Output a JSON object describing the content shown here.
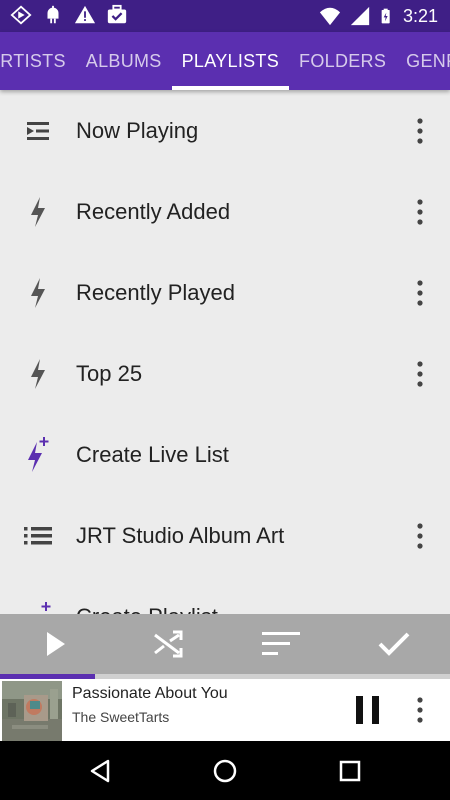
{
  "status_bar": {
    "time": "3:21",
    "icons": [
      "media-player-icon",
      "android-debug-icon",
      "warning-icon",
      "briefcase-check-icon",
      "wifi-icon",
      "signal-icon",
      "battery-charging-icon"
    ]
  },
  "tabs": [
    {
      "label": "ARTISTS",
      "active": false
    },
    {
      "label": "ALBUMS",
      "active": false
    },
    {
      "label": "PLAYLISTS",
      "active": true
    },
    {
      "label": "FOLDERS",
      "active": false
    },
    {
      "label": "GENRES",
      "active": false
    }
  ],
  "playlists": [
    {
      "label": "Now Playing",
      "icon": "now-playing-icon",
      "has_menu": true
    },
    {
      "label": "Recently Added",
      "icon": "lightning-icon",
      "has_menu": true
    },
    {
      "label": "Recently Played",
      "icon": "lightning-icon",
      "has_menu": true
    },
    {
      "label": "Top 25",
      "icon": "lightning-icon",
      "has_menu": true
    },
    {
      "label": "Create Live List",
      "icon": "lightning-plus-icon",
      "has_menu": false
    },
    {
      "label": "JRT Studio Album Art",
      "icon": "list-icon",
      "has_menu": true
    },
    {
      "label": "Create Playlist",
      "icon": "list-plus-icon",
      "has_menu": false
    }
  ],
  "controls": [
    "play-icon",
    "shuffle-icon",
    "sort-icon",
    "check-icon"
  ],
  "playback": {
    "progress": 0.21
  },
  "now_playing": {
    "title": "Passionate About You",
    "artist": "The SweetTarts"
  },
  "colors": {
    "status_bar": "#3f1f86",
    "tab_bar": "#5b2fb0",
    "accent": "#5b2fb0",
    "list_background": "#ececec",
    "controls_background": "#a8a8a8"
  }
}
